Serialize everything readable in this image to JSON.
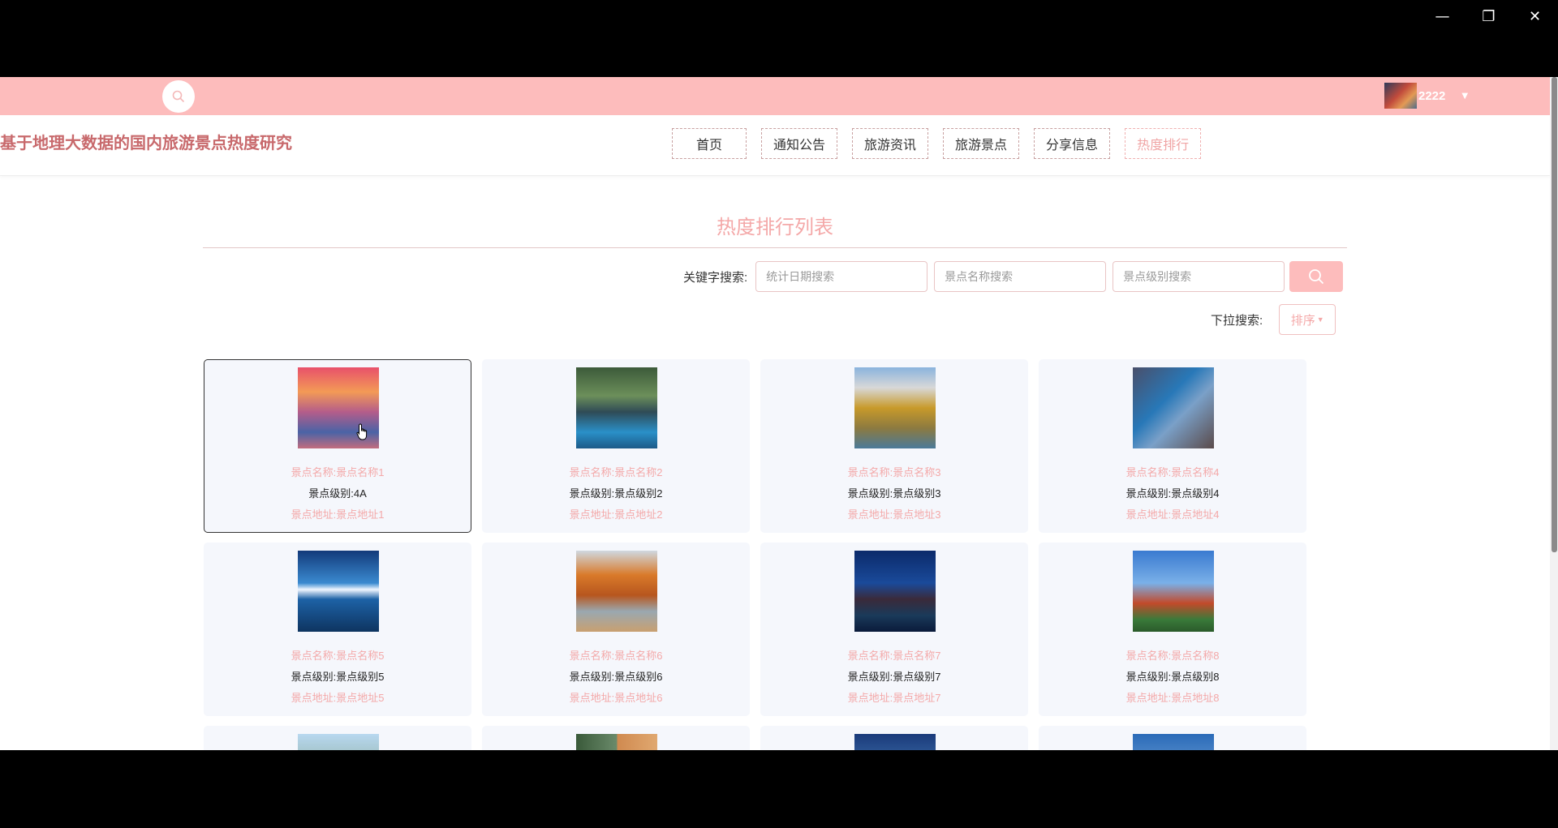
{
  "topbar": {
    "username": "2222"
  },
  "header": {
    "site_title": "基于地理大数据的国内旅游景点热度研究",
    "nav": [
      {
        "label": "首页",
        "active": false
      },
      {
        "label": "通知公告",
        "active": false
      },
      {
        "label": "旅游资讯",
        "active": false
      },
      {
        "label": "旅游景点",
        "active": false
      },
      {
        "label": "分享信息",
        "active": false
      },
      {
        "label": "热度排行",
        "active": true
      }
    ]
  },
  "main": {
    "list_title": "热度排行列表",
    "search": {
      "label": "关键字搜索:",
      "date_placeholder": "统计日期搜索",
      "name_placeholder": "景点名称搜索",
      "level_placeholder": "景点级别搜索"
    },
    "dropdown": {
      "label": "下拉搜索:",
      "sort_label": "排序"
    },
    "cards": [
      {
        "name": "景点名称:景点名称1",
        "level": "景点级别:4A",
        "addr": "景点地址:景点地址1"
      },
      {
        "name": "景点名称:景点名称2",
        "level": "景点级别:景点级别2",
        "addr": "景点地址:景点地址2"
      },
      {
        "name": "景点名称:景点名称3",
        "level": "景点级别:景点级别3",
        "addr": "景点地址:景点地址3"
      },
      {
        "name": "景点名称:景点名称4",
        "level": "景点级别:景点级别4",
        "addr": "景点地址:景点地址4"
      },
      {
        "name": "景点名称:景点名称5",
        "level": "景点级别:景点级别5",
        "addr": "景点地址:景点地址5"
      },
      {
        "name": "景点名称:景点名称6",
        "level": "景点级别:景点级别6",
        "addr": "景点地址:景点地址6"
      },
      {
        "name": "景点名称:景点名称7",
        "level": "景点级别:景点级别7",
        "addr": "景点地址:景点地址7"
      },
      {
        "name": "景点名称:景点名称8",
        "level": "景点级别:景点级别8",
        "addr": "景点地址:景点地址8"
      }
    ]
  },
  "colors": {
    "accent_pink": "#fdbcbc",
    "title_red": "#c8696c",
    "label_pink": "#f4a8a8",
    "card_bg": "#f5f7fc"
  }
}
